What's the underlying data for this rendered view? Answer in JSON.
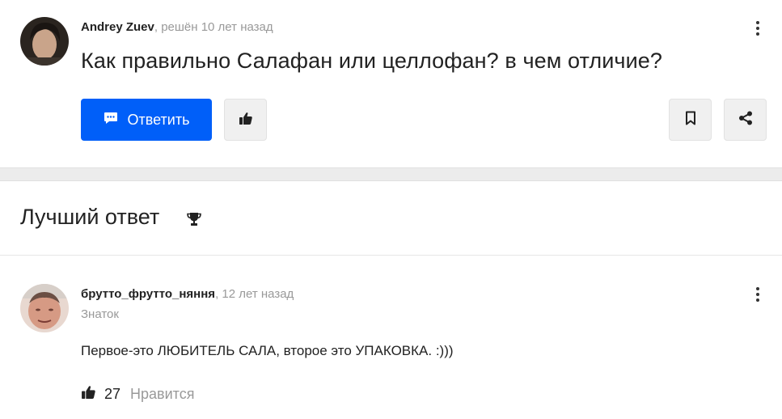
{
  "question": {
    "author": "Andrey Zuev",
    "status": ", решён 10 лет назад",
    "title": "Как правильно Салафан или целлофан? в чем отличие?",
    "answer_button_label": "Ответить",
    "icons": {
      "answer": "chat-bubble-icon",
      "like": "thumbs-up-icon",
      "bookmark": "bookmark-icon",
      "share": "share-icon",
      "menu": "kebab-menu-icon"
    }
  },
  "best_answer": {
    "heading": "Лучший ответ",
    "heading_icon": "trophy-icon",
    "author": "брутто_фрутто_няння",
    "time": ", 12 лет назад",
    "role": "Знаток",
    "text": "Первое-это ЛЮБИТЕЛЬ САЛА, второе это УПАКОВКА. :)))",
    "likes": "27",
    "like_label": "Нравится"
  },
  "colors": {
    "primary": "#005ff9",
    "text": "#222222",
    "muted": "#999999",
    "band": "#ececec"
  }
}
